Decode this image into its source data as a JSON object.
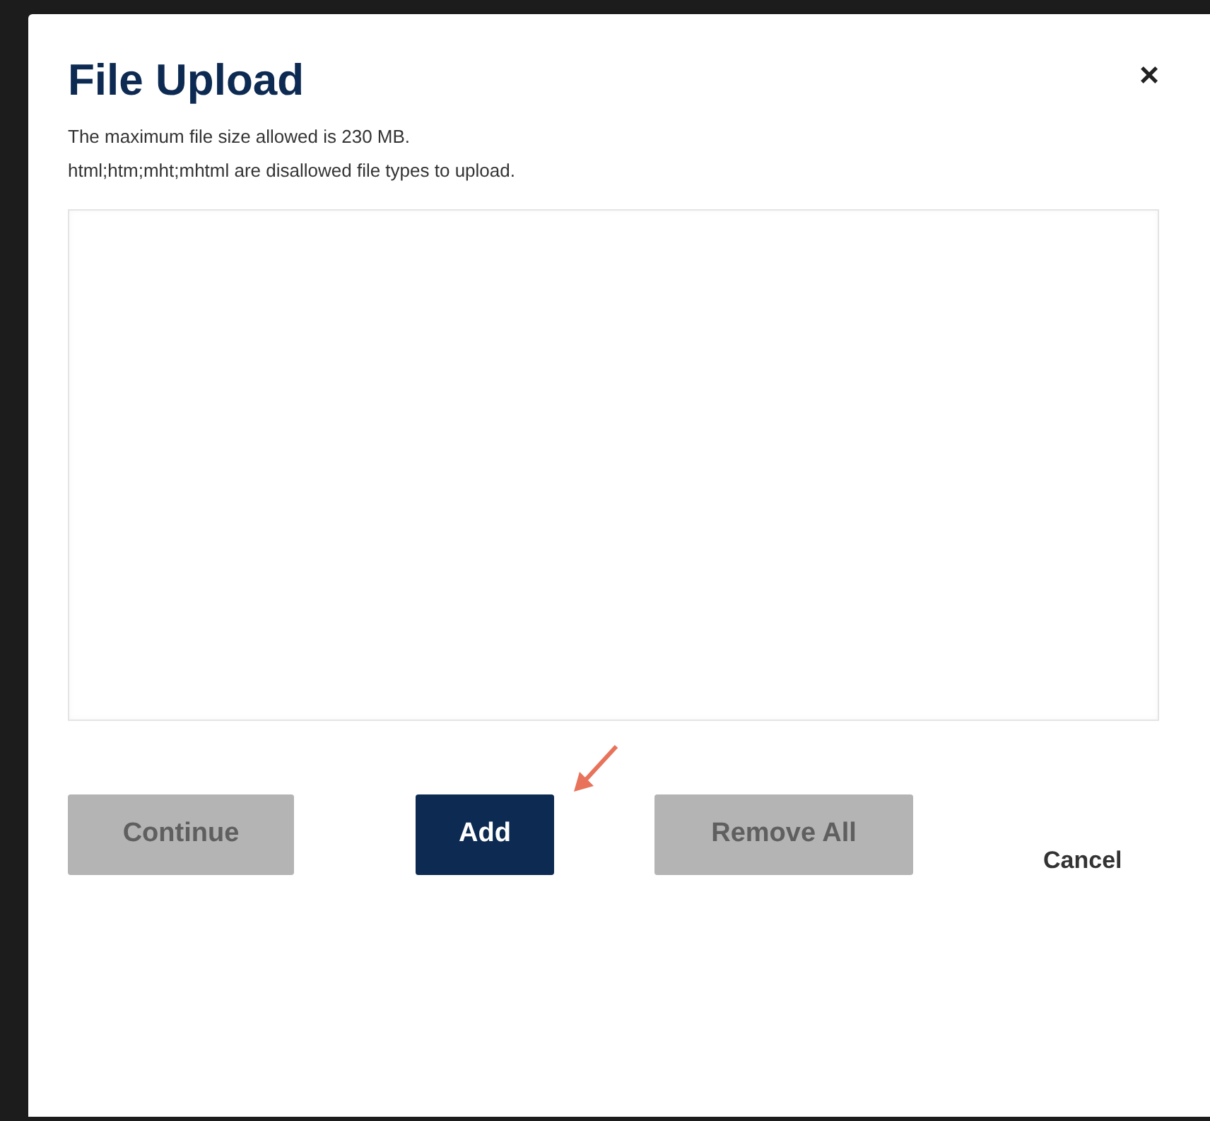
{
  "dialog": {
    "title": "File Upload",
    "close": "×",
    "notes": [
      "The maximum file size allowed is 230 MB.",
      "html;htm;mht;mhtml are disallowed file types to upload."
    ],
    "buttons": [
      {
        "label": "Continue",
        "kind": "solid",
        "disabled": true
      },
      {
        "label": "Add",
        "kind": "solid",
        "disabled": false
      },
      {
        "label": "Remove All",
        "kind": "solid",
        "disabled": true
      },
      {
        "label": "Cancel",
        "kind": "link",
        "disabled": false
      }
    ]
  }
}
